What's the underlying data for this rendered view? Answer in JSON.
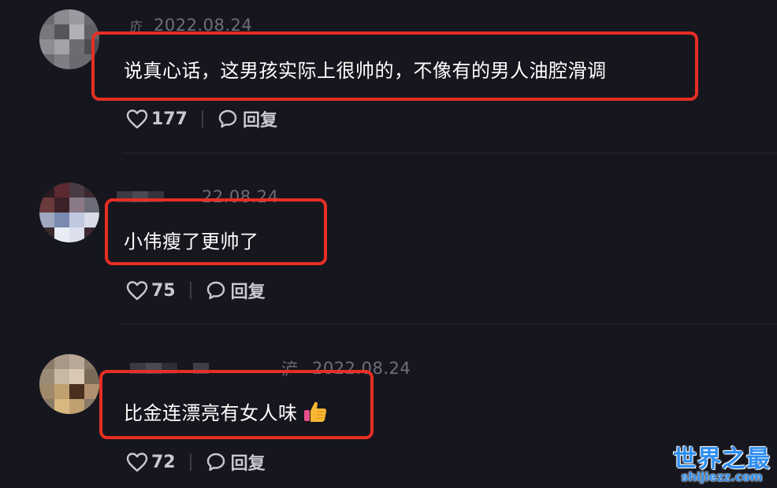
{
  "comments": [
    {
      "date": "2022.08.24",
      "name_prefix": "",
      "text": "说真心话，这男孩实际上很帅的，不像有的男人油腔滑调",
      "likes": "177",
      "reply_label": "回复"
    },
    {
      "date": "22.08.24",
      "name_prefix": "",
      "text": "小伟瘦了更帅了",
      "likes": "75",
      "reply_label": "回复"
    },
    {
      "date": "2022.08.24",
      "name_prefix": "浐",
      "text": "比金连漂亮有女人味",
      "emoji": "thumbs-up-icon",
      "likes": "72",
      "reply_label": "回复"
    }
  ],
  "watermark": {
    "cn": "世界之最",
    "en": "shijiezz.com"
  },
  "colors": {
    "background": "#16161e",
    "highlight": "#e62e24",
    "meta_text": "#6e6e78",
    "action_text": "#c8c8d0",
    "watermark": "#2d8ef0"
  }
}
